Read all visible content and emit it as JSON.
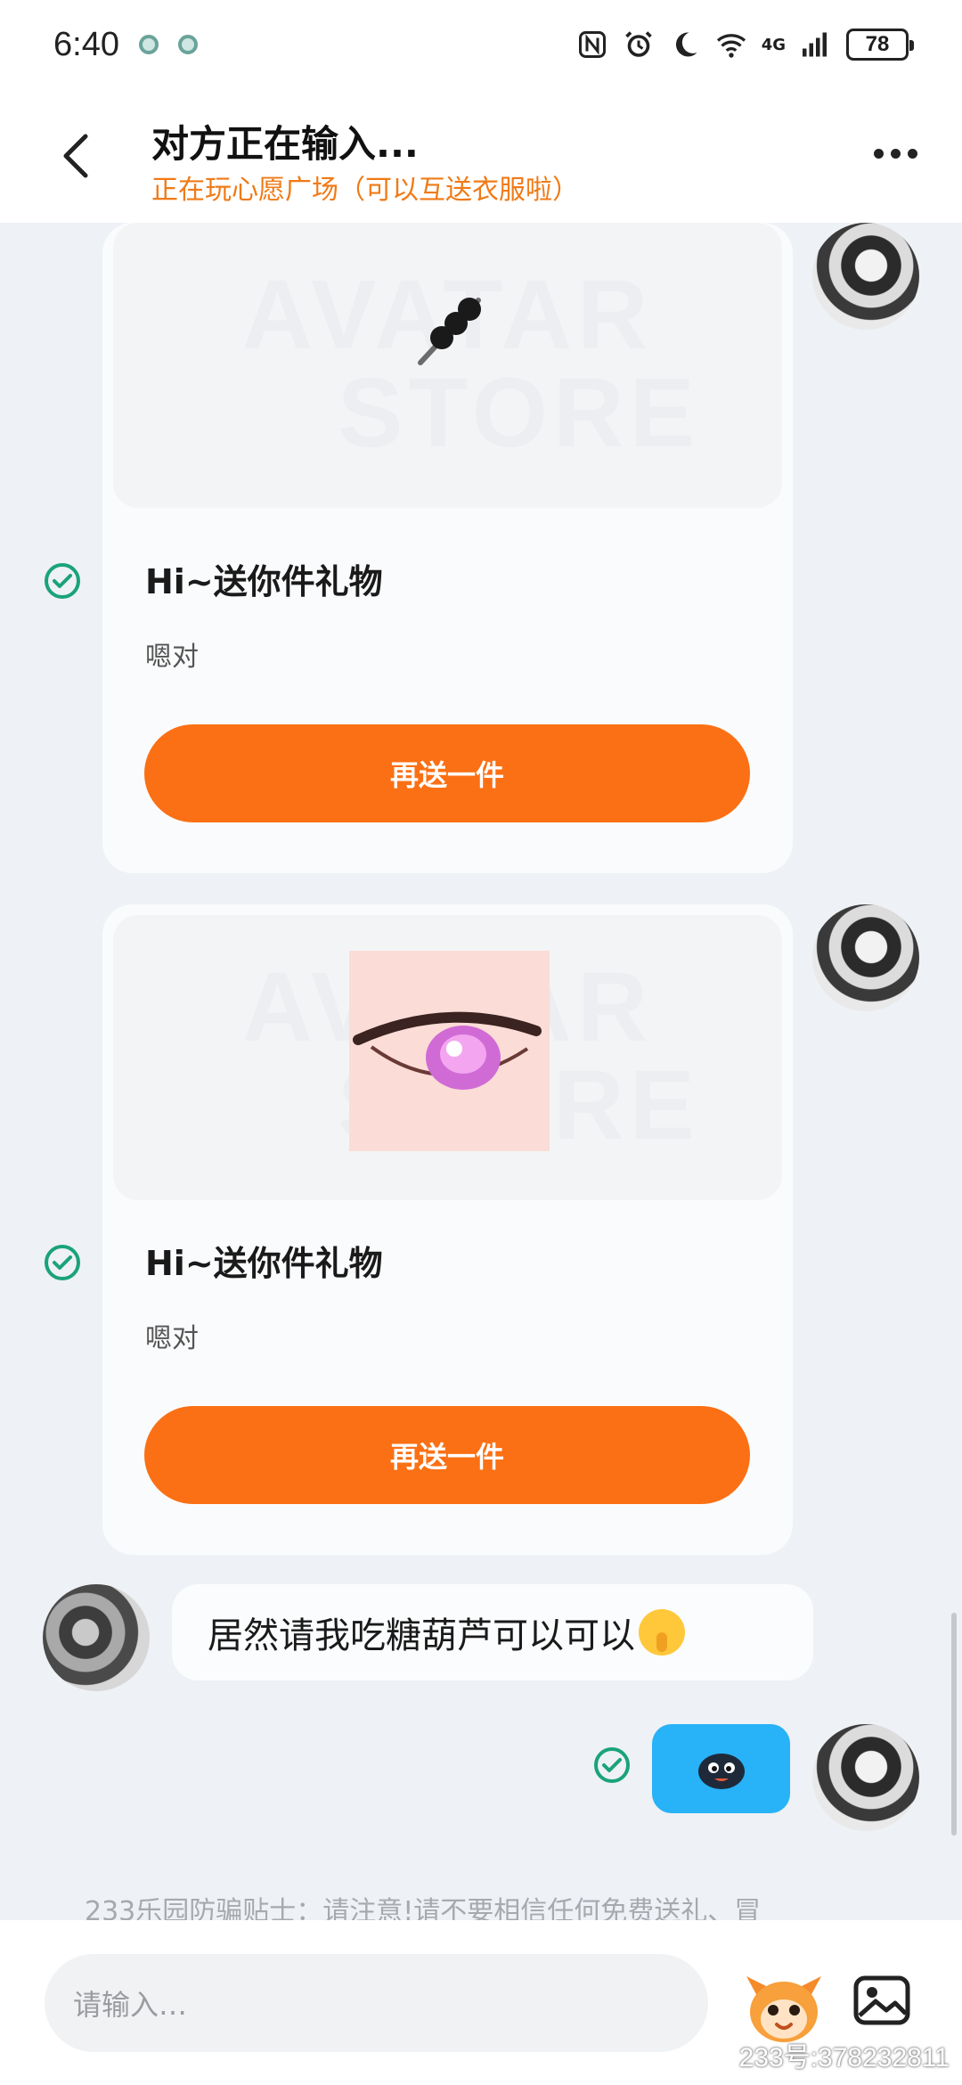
{
  "status_bar": {
    "time": "6:40",
    "network": "4G",
    "battery": "78"
  },
  "header": {
    "title": "对方正在输入...",
    "subtitle": "正在玩心愿广场（可以互送衣服啦）"
  },
  "watermark": {
    "line1": "AVATAR",
    "line2": "STORE"
  },
  "messages": [
    {
      "type": "gift",
      "item_icon": "candied-haw-skewer-icon",
      "title": "Hi~送你件礼物",
      "desc": "嗯对",
      "button": "再送一件",
      "status": "read"
    },
    {
      "type": "gift",
      "item_icon": "eye-makeup-icon",
      "title": "Hi~送你件礼物",
      "desc": "嗯对",
      "button": "再送一件",
      "status": "read"
    },
    {
      "type": "text",
      "text": "居然请我吃糖葫芦可以可以",
      "emoji": "shushing-face-emoji"
    },
    {
      "type": "sticker",
      "sticker": "dark-blob-sticker",
      "status": "read"
    }
  ],
  "footer": {
    "tip": "233乐园防骗贴士：请注意!请不要相信任何免费送礼、冒",
    "input_placeholder": "请输入…",
    "watermark_id": "233号:378232811"
  },
  "colors": {
    "accent": "#fb7014",
    "subtitle": "#f07a17",
    "sticker_bg": "#28b2f7",
    "check": "#1aa37a"
  }
}
